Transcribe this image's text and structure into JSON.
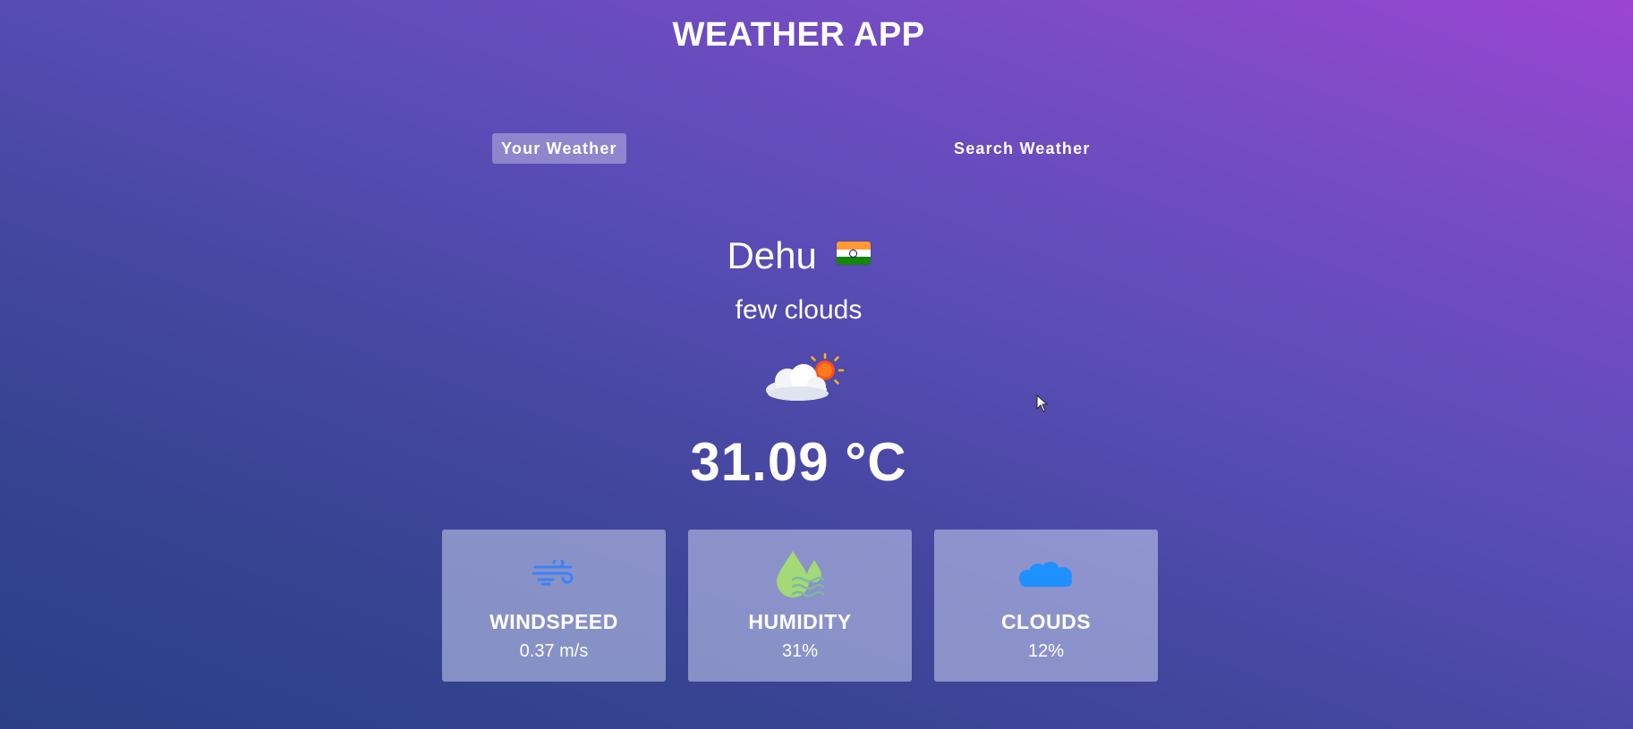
{
  "app": {
    "title": "WEATHER APP"
  },
  "tabs": [
    {
      "label": "Your Weather",
      "active": true
    },
    {
      "label": "Search Weather",
      "active": false
    }
  ],
  "weather": {
    "city": "Dehu",
    "country_flag_icon": "india-flag-icon",
    "description": "few clouds",
    "icon": "few-clouds-icon",
    "temperature": "31.09 °C"
  },
  "stats": [
    {
      "icon": "wind-icon",
      "label": "WINDSPEED",
      "value": "0.37 m/s",
      "icon_color": "#3b82f6"
    },
    {
      "icon": "humidity-icon",
      "label": "HUMIDITY",
      "value": "31%",
      "icon_color": "#a3d977"
    },
    {
      "icon": "cloud-icon",
      "label": "CLOUDS",
      "value": "12%",
      "icon_color": "#1e90ff"
    }
  ],
  "colors": {
    "background_top_right": "#9b45d2",
    "background_bottom_left": "#2b3f86",
    "active_tab_bg": "rgba(255,255,255,0.32)",
    "card_bg": "rgba(200,210,240,0.55)"
  }
}
